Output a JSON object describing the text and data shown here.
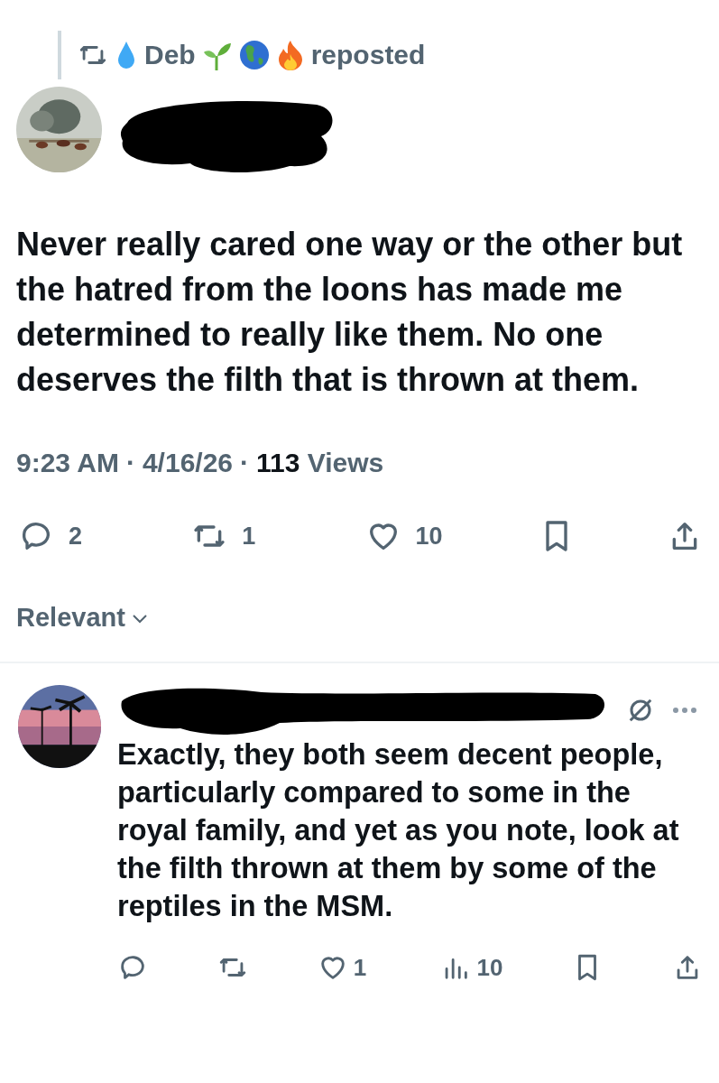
{
  "repost_banner": {
    "name": "Deb",
    "label": "reposted"
  },
  "post": {
    "redacted_author": true,
    "text": "Never really cared one way or the other but the hatred from the loons has made me determined to really like them. No one deserves the filth that is thrown at them.",
    "time": "9:23 AM",
    "separator_1": "·",
    "date": "4/16/26",
    "separator_2": "·",
    "views_count": "113",
    "views_label": "Views",
    "actions": [
      {
        "kind": "reply",
        "count": "2"
      },
      {
        "kind": "repost",
        "count": "1"
      },
      {
        "kind": "like",
        "count": "10"
      },
      {
        "kind": "bookmark"
      },
      {
        "kind": "share"
      }
    ]
  },
  "sort": {
    "label": "Relevant"
  },
  "replies": [
    {
      "redacted_author": true,
      "text": "Exactly, they both seem decent people, particularly compared to some in the royal family, and yet as you note, look at the filth thrown at them by some of the reptiles in the MSM.",
      "actions": [
        {
          "kind": "reply"
        },
        {
          "kind": "repost"
        },
        {
          "kind": "like",
          "count": "1"
        },
        {
          "kind": "views",
          "count": "10"
        },
        {
          "kind": "bookmark"
        },
        {
          "kind": "share"
        }
      ]
    }
  ]
}
